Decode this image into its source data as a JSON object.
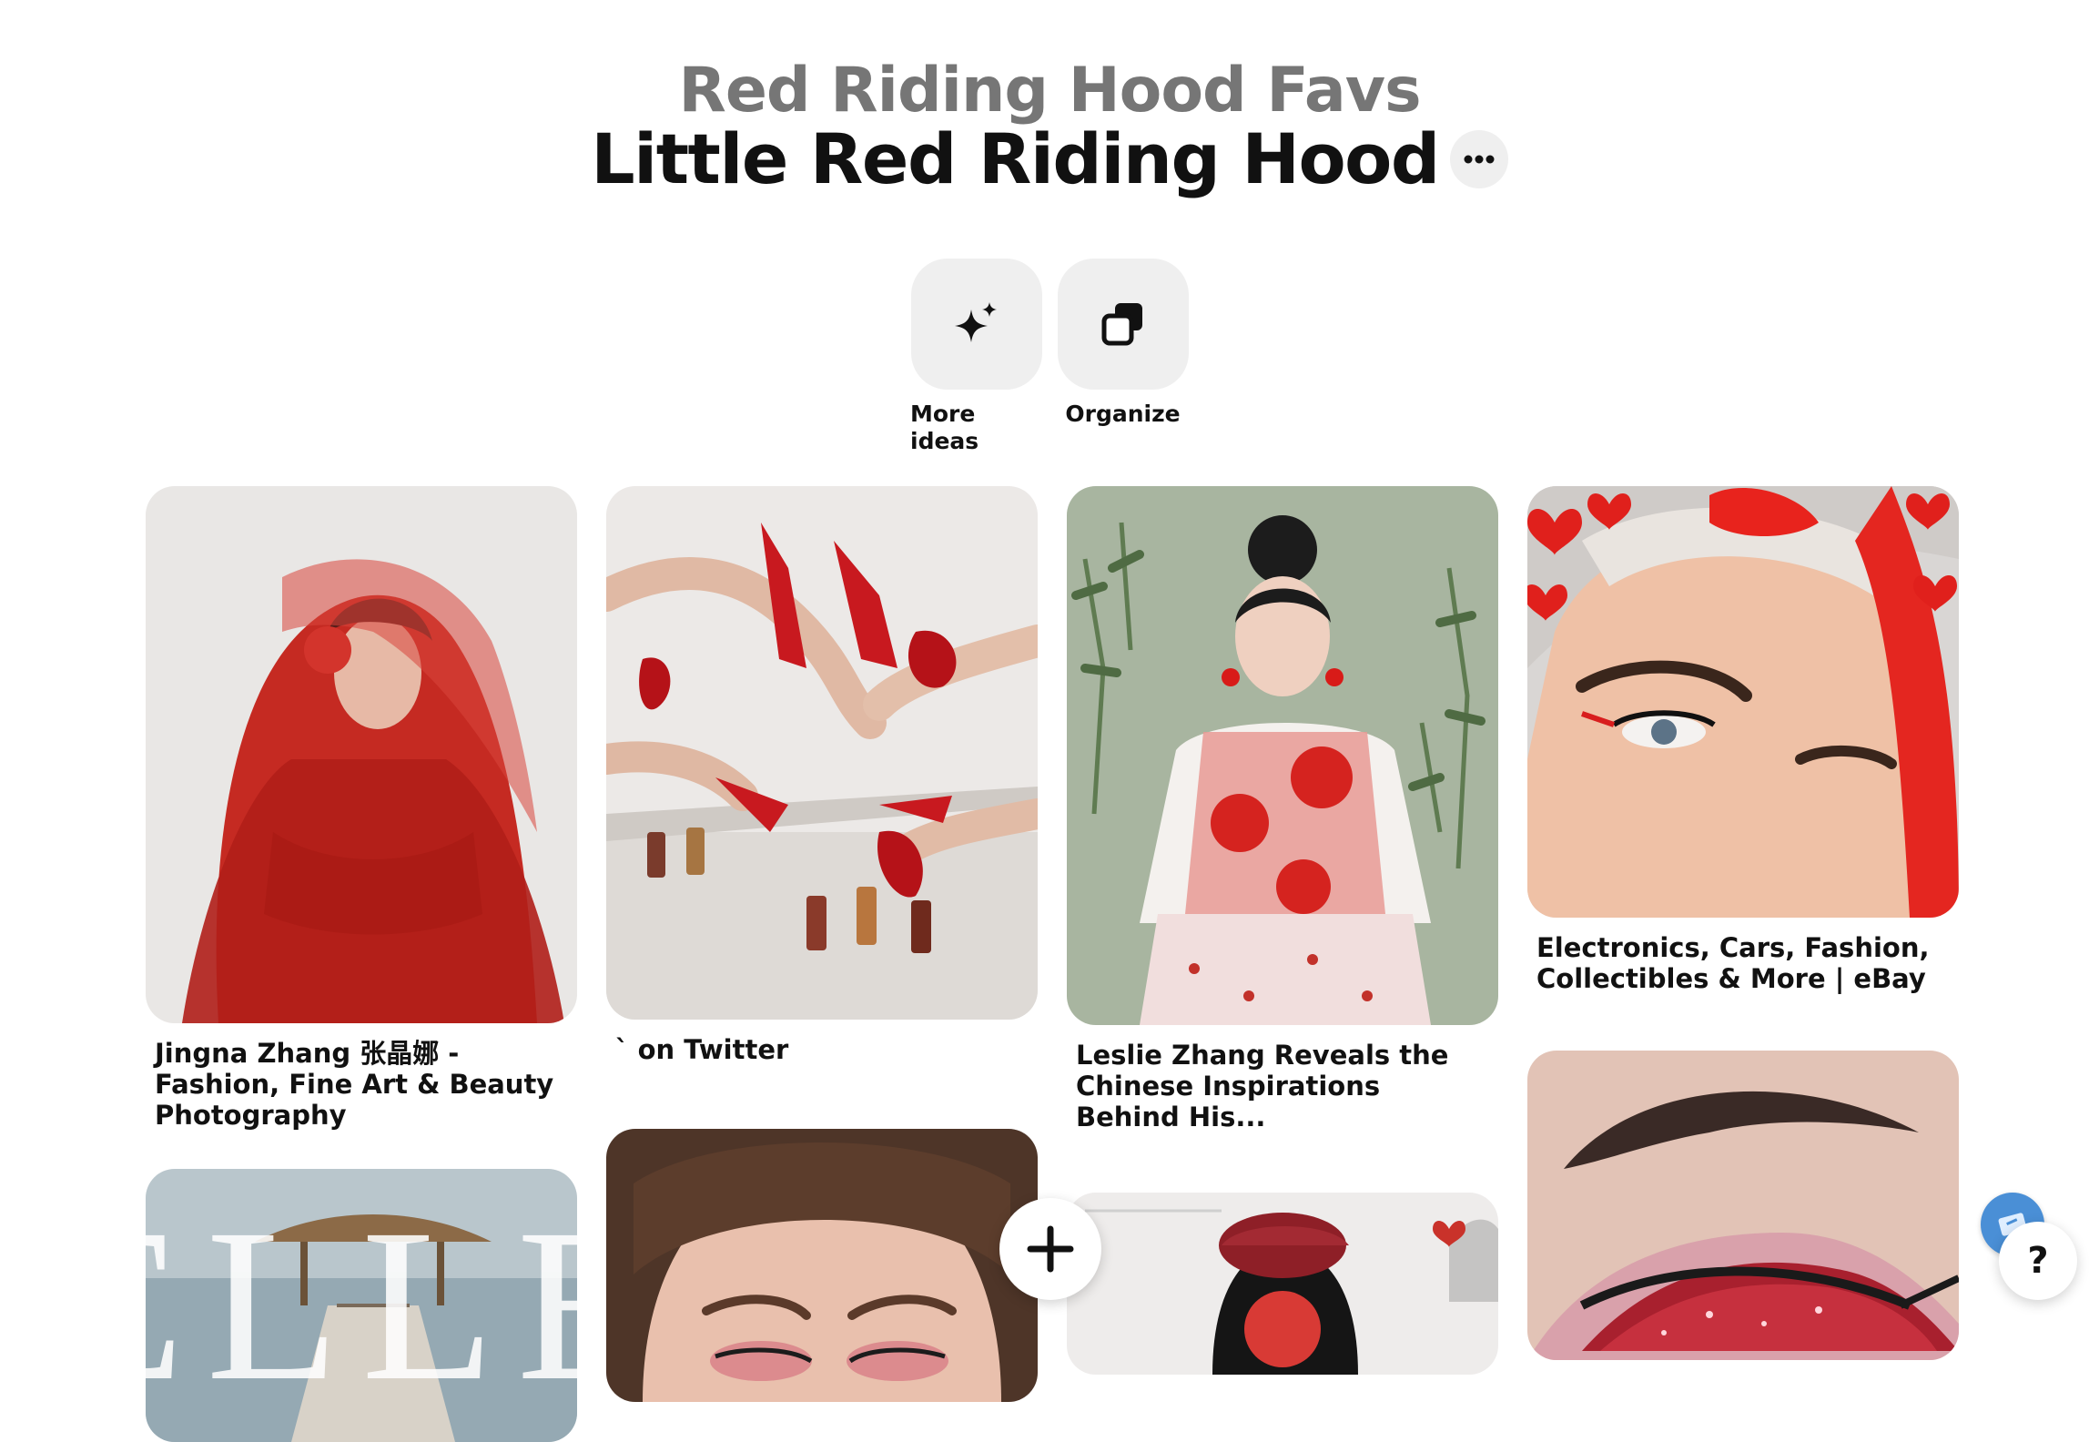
{
  "board": {
    "parent_name": "Red Riding Hood Favs",
    "title": "Little Red Riding Hood",
    "more_icon": "more-horizontal-icon"
  },
  "actions": [
    {
      "label": "More ideas",
      "icon": "sparkle-icon"
    },
    {
      "label": "Organize",
      "icon": "organize-icon"
    }
  ],
  "pins": [
    {
      "title": "Jingna Zhang 张晶娜 - Fashion, Fine Art & Beauty Photography"
    },
    {
      "title": "` on Twitter"
    },
    {
      "title": "Leslie Zhang Reveals the Chinese Inspirations Behind His..."
    },
    {
      "title": "Electronics, Cars, Fashion, Collectibles & More | eBay"
    },
    {
      "title": "",
      "magazine_logo": "ELLE"
    },
    {
      "title": ""
    },
    {
      "title": ""
    },
    {
      "title": ""
    }
  ],
  "fab": {
    "icon": "plus-icon"
  },
  "help": {
    "label": "?",
    "icon": "help-icon"
  },
  "colors": {
    "accent": "#e60023",
    "muted": "#767676",
    "button_bg": "#efefef"
  }
}
